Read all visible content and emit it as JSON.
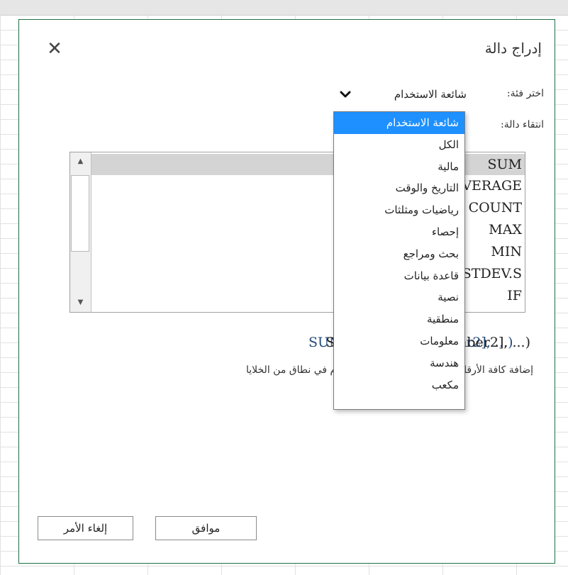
{
  "dialog": {
    "title": "إدراج دالة",
    "close_glyph": "✕"
  },
  "category": {
    "label": "اختر فئة:",
    "selected": "شائعة الاستخدام"
  },
  "function_select": {
    "label": "انتقاء دالة:"
  },
  "function_list": [
    "SUM",
    "AVERAGE",
    "COUNT",
    "MAX",
    "MIN",
    "STDEV.S",
    "IF"
  ],
  "syntax": {
    "left": "SUM(number1,[number2], ...)",
    "right": "SUM(number1,[number2], ...)"
  },
  "description": {
    "right": "إضافة كافة الأرقام في نطاق من الخلايا",
    "left": "إضافة كافة الأرقام في نطاق من الخلايا"
  },
  "buttons": {
    "ok": "موافق",
    "cancel": "إلغاء الأمر"
  },
  "dropdown_options": [
    "شائعة الاستخدام",
    "الكل",
    "مالية",
    "التاريخ والوقت",
    "رياضيات ومثلثات",
    "إحصاء",
    "بحث ومراجع",
    "قاعدة بيانات",
    "نصية",
    "منطقية",
    "معلومات",
    "هندسة",
    "مكعب"
  ],
  "colors": {
    "dialog_border": "#1e7145",
    "selection": "#1e90ff",
    "syntax_link": "#1f497d"
  }
}
